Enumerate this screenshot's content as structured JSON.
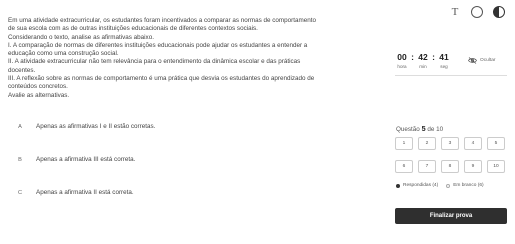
{
  "toolbar": {
    "text_icon": "T"
  },
  "question": {
    "lines": [
      "Em uma atividade extracurricular, os estudantes foram incentivados a comparar as normas de comportamento",
      "de sua escola com as de outras instituições educacionais de diferentes contextos sociais.",
      "Considerando o texto, analise as afirmativas abaixo.",
      "I. A comparação de normas de diferentes instituições educacionais pode ajudar os estudantes a entender a",
      "educação como uma construção social.",
      "II. A atividade extracurricular não tem relevância para o entendimento da dinâmica escolar e das práticas",
      "docentes.",
      "III. A reflexão sobre as normas de comportamento é uma prática que desvia os estudantes do aprendizado de",
      "conteúdos concretos.",
      "Avalie as alternativas."
    ]
  },
  "alternatives": [
    {
      "letter": "A",
      "text": "Apenas as afirmativas I e II estão corretas."
    },
    {
      "letter": "B",
      "text": "Apenas a afirmativa III está correta."
    },
    {
      "letter": "C",
      "text": "Apenas a afirmativa II está correta."
    }
  ],
  "timer": {
    "hours": "00",
    "minutes": "42",
    "seconds": "41",
    "hours_label": "hora",
    "minutes_label": "min",
    "seconds_label": "seg",
    "separator": ":",
    "hide_label": "Ocultar"
  },
  "progress": {
    "prefix": "Questão",
    "current": "5",
    "of": "de 10"
  },
  "questions": [
    "1",
    "2",
    "3",
    "4",
    "5",
    "6",
    "7",
    "8",
    "9",
    "10"
  ],
  "legend": {
    "answered": "Respondidas (4)",
    "blank": "Em branco (6)"
  },
  "finish_label": "Finalizar prova"
}
